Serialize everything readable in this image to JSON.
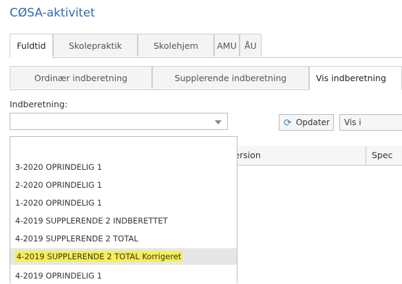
{
  "app": {
    "title": "CØSA-aktivitet"
  },
  "tabs_primary": [
    {
      "label": "Fuldtid"
    },
    {
      "label": "Skolepraktik"
    },
    {
      "label": "Skolehjem"
    },
    {
      "label": "AMU"
    },
    {
      "label": "ÅU"
    }
  ],
  "tabs_secondary": [
    {
      "label": "Ordinær indberetning"
    },
    {
      "label": "Supplerende indberetning"
    },
    {
      "label": "Vis indberetning"
    }
  ],
  "form": {
    "label": "Indberetning:",
    "select_value": "",
    "refresh_label": "Opdater",
    "show_label": "Vis i"
  },
  "grid": {
    "columns": [
      "version",
      "Spec"
    ]
  },
  "dropdown": {
    "options": [
      "",
      "3-2020 OPRINDELIG 1",
      "2-2020 OPRINDELIG 1",
      "1-2020 OPRINDELIG 1",
      "4-2019 SUPPLERENDE 2 INDBERETTET",
      "4-2019 SUPPLERENDE 2 TOTAL",
      "4-2019 SUPPLERENDE 2 TOTAL Korrigeret",
      "4-2019 OPRINDELIG 1"
    ],
    "highlighted_index": 6
  },
  "colors": {
    "accent": "#2c6bb0",
    "highlight": "#f6ef55"
  }
}
